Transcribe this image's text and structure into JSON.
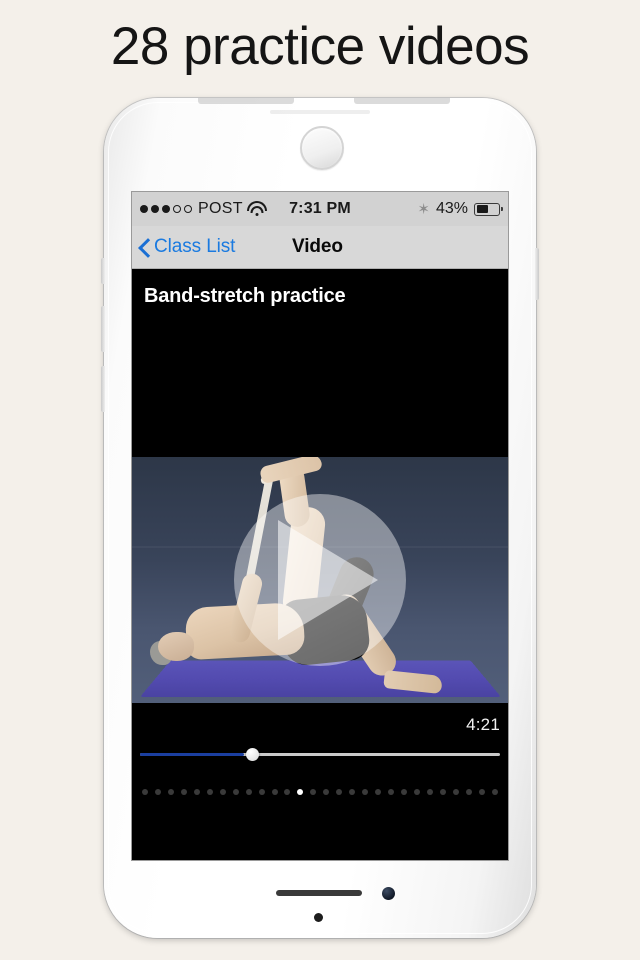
{
  "headline": "28 practice videos",
  "colors": {
    "background": "#f4f0ea",
    "accent_blue": "#1a7ae0",
    "progress_blue": "#1b3fa0",
    "statusbar_bg": "#d2d2d2",
    "navbar_bg": "#d8d8d8",
    "screen_black": "#000000",
    "mat_purple": "#534bb0"
  },
  "status_bar": {
    "signal_dots_filled": 3,
    "signal_dots_empty": 2,
    "carrier": "POST",
    "wifi_icon": "wifi-icon",
    "time": "7:31 PM",
    "bluetooth_icon": "✶",
    "battery_percent": "43%",
    "battery_fill_pct": 55
  },
  "nav_bar": {
    "back_icon": "chevron-left-icon",
    "back_label": "Class List",
    "title": "Video"
  },
  "video": {
    "title": "Band-stretch practice",
    "play_icon": "play-icon",
    "duration": "4:21",
    "progress_pct": 29,
    "scene_description": "person lying on purple mat doing band stretch"
  },
  "pager": {
    "total": 28,
    "active_index": 12
  },
  "device": {
    "camera_icon": "front-camera-icon",
    "earpiece_icon": "earpiece-icon",
    "speaker_icon": "speaker-grille-icon",
    "mic_icon": "microphone-icon",
    "home_indicator_icon": "home-dot-icon"
  }
}
